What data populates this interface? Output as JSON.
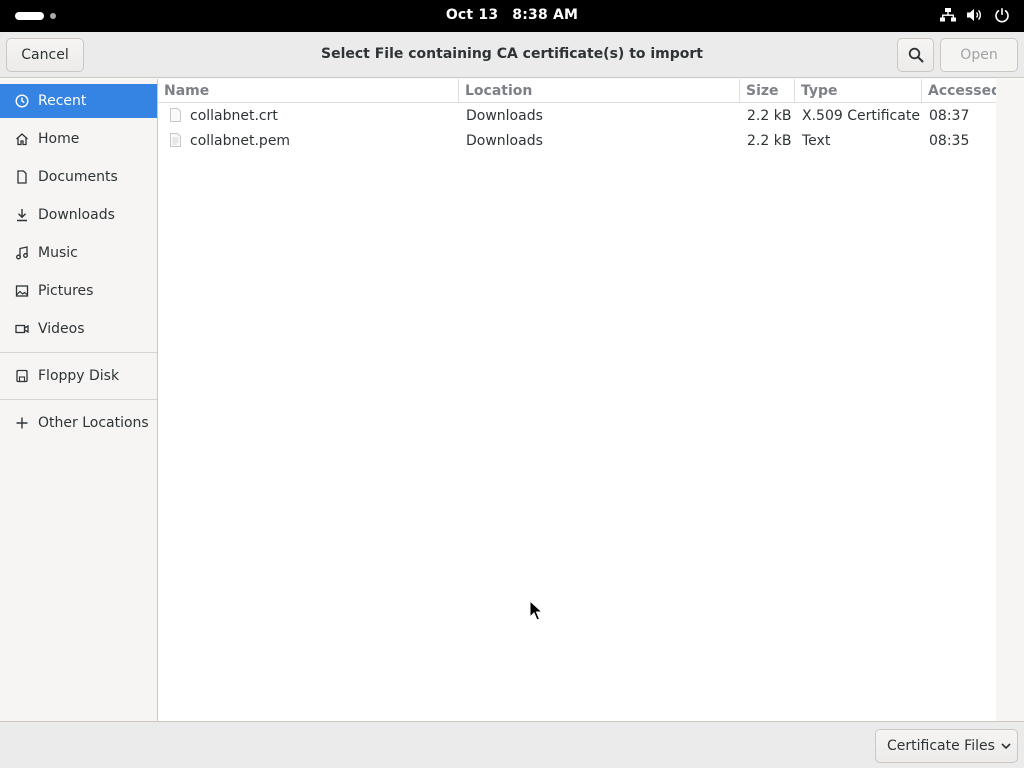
{
  "topbar": {
    "date": "Oct 13",
    "time": "8:38 AM"
  },
  "header": {
    "cancel_label": "Cancel",
    "title": "Select File containing CA certificate(s) to import",
    "open_label": "Open"
  },
  "sidebar": {
    "items": [
      {
        "label": "Recent",
        "icon": "clock-icon",
        "active": true
      },
      {
        "label": "Home",
        "icon": "home-icon"
      },
      {
        "label": "Documents",
        "icon": "document-icon"
      },
      {
        "label": "Downloads",
        "icon": "download-icon"
      },
      {
        "label": "Music",
        "icon": "music-icon"
      },
      {
        "label": "Pictures",
        "icon": "picture-icon"
      },
      {
        "label": "Videos",
        "icon": "video-icon"
      },
      {
        "label": "Floppy Disk",
        "icon": "floppy-icon"
      },
      {
        "label": "Other Locations",
        "icon": "plus-icon"
      }
    ]
  },
  "table": {
    "columns": [
      "Name",
      "Location",
      "Size",
      "Type",
      "Accessed"
    ],
    "rows": [
      {
        "name": "collabnet.crt",
        "location": "Downloads",
        "size": "2.2 kB",
        "type": "X.509 Certificate",
        "accessed": "08:37"
      },
      {
        "name": "collabnet.pem",
        "location": "Downloads",
        "size": "2.2 kB",
        "type": "Text",
        "accessed": "08:35"
      }
    ]
  },
  "filter": {
    "label": "Certificate Files"
  },
  "colors": {
    "accent": "#3584e4",
    "topbar": "#000000"
  }
}
